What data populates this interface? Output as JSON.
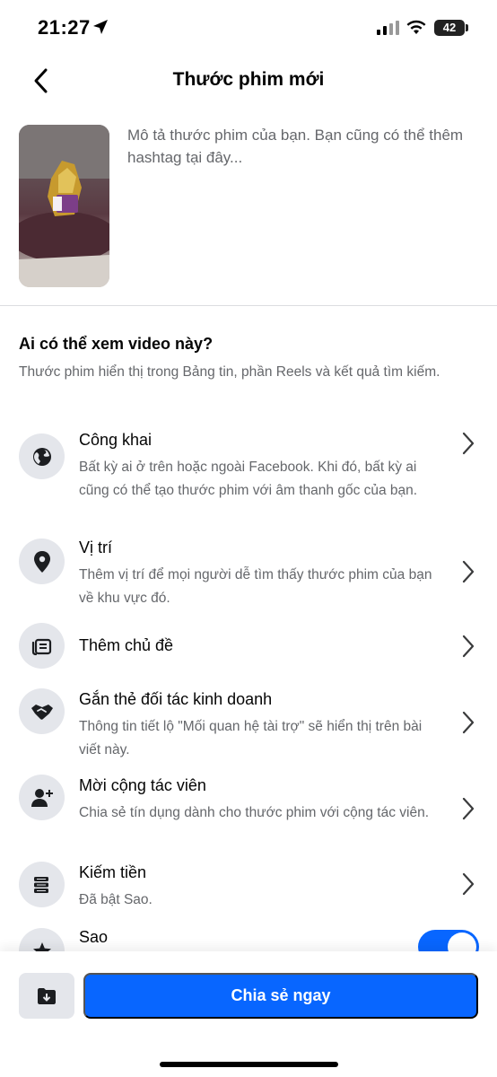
{
  "status": {
    "time": "21:27",
    "battery": "42"
  },
  "nav": {
    "title": "Thước phim mới"
  },
  "composer": {
    "placeholder": "Mô tả thước phim của bạn. Bạn cũng có thể thêm hashtag tại đây..."
  },
  "audience": {
    "title": "Ai có thể xem video này?",
    "description": "Thước phim hiển thị trong Bảng tin, phần Reels và kết quả tìm kiếm."
  },
  "options": [
    {
      "icon": "globe-icon",
      "title": "Công khai",
      "description": "Bất kỳ ai ở trên hoặc ngoài Facebook. Khi đó, bất kỳ ai cũng có thể tạo thước phim với âm thanh gốc của bạn."
    },
    {
      "icon": "location-pin-icon",
      "title": "Vị trí",
      "description": "Thêm vị trí để mọi người dễ tìm thấy thước phim của bạn về khu vực đó."
    },
    {
      "icon": "topic-icon",
      "title": "Thêm chủ đề",
      "description": ""
    },
    {
      "icon": "handshake-icon",
      "title": "Gắn thẻ đối tác kinh doanh",
      "description": "Thông tin tiết lộ \"Mối quan hệ tài trợ\" sẽ hiển thị trên bài viết này."
    },
    {
      "icon": "add-person-icon",
      "title": "Mời cộng tác viên",
      "description": "Chia sẻ tín dụng dành cho thước phim với cộng tác viên."
    },
    {
      "icon": "coins-icon",
      "title": "Kiếm tiền",
      "description": "Đã bật Sao."
    },
    {
      "icon": "star-icon",
      "title": "Sao",
      "description": "",
      "toggle_on": true
    }
  ],
  "footer": {
    "share_label": "Chia sẻ ngay"
  },
  "colors": {
    "accent": "#0866ff",
    "icon_bg": "#e4e6eb",
    "secondary_text": "#65676b"
  }
}
